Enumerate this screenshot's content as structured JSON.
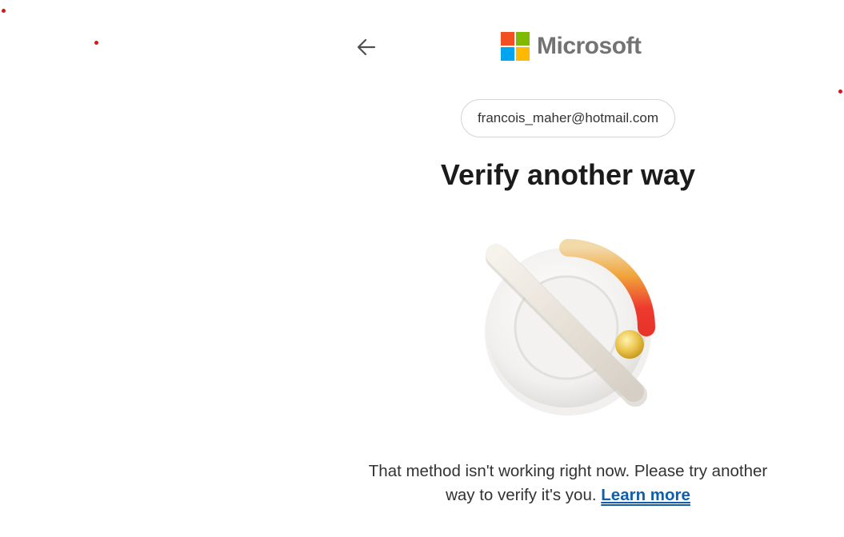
{
  "header": {
    "back_icon": "back-arrow-icon",
    "brand": {
      "name": "Microsoft",
      "colors": {
        "red": "#F25022",
        "green": "#7FBA00",
        "blue": "#00A4EF",
        "yellow": "#FFB900"
      }
    }
  },
  "identity": {
    "email": "francois_maher@hotmail.com"
  },
  "main": {
    "title": "Verify another way",
    "illustration_icon": "blocked-gauge-icon",
    "message": "That method isn't working right now. Please try another way to verify it's you.",
    "learn_more_label": "Learn more"
  },
  "theme": {
    "link_color": "#0F5FAD",
    "text_color": "#1B1B1B"
  }
}
